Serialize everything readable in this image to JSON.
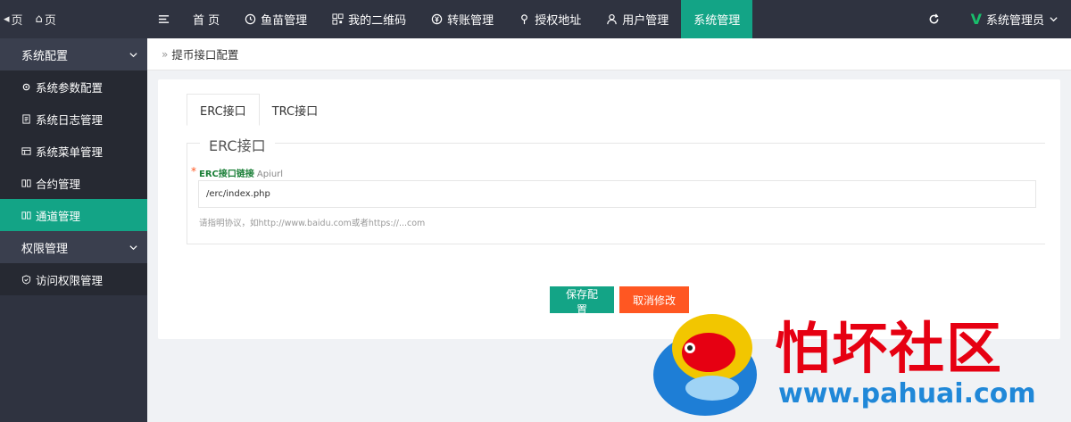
{
  "topbar": {
    "left_links": [
      {
        "icon": "back-icon",
        "label": "页"
      },
      {
        "icon": "home-icon",
        "label": "页"
      }
    ],
    "nav": [
      {
        "name": "nav-menu-toggle",
        "icon": "menu-icon",
        "label": ""
      },
      {
        "name": "nav-home",
        "icon": "",
        "label": "首 页"
      },
      {
        "name": "nav-fish",
        "icon": "fish-icon",
        "label": "鱼苗管理"
      },
      {
        "name": "nav-qrcode",
        "icon": "qrcode-icon",
        "label": "我的二维码"
      },
      {
        "name": "nav-transfer",
        "icon": "yen-icon",
        "label": "转账管理"
      },
      {
        "name": "nav-auth-address",
        "icon": "location-icon",
        "label": "授权地址"
      },
      {
        "name": "nav-users",
        "icon": "user-icon",
        "label": "用户管理"
      },
      {
        "name": "nav-system",
        "icon": "",
        "label": "系统管理",
        "active": true
      }
    ],
    "refresh_icon": "refresh-icon",
    "admin_label": "系统管理员",
    "admin_logo": "V"
  },
  "sidebar": {
    "groups": [
      {
        "label": "系统配置",
        "items": [
          {
            "icon": "gear-icon",
            "label": "系统参数配置"
          },
          {
            "icon": "document-icon",
            "label": "系统日志管理"
          },
          {
            "icon": "menu-table-icon",
            "label": "系统菜单管理"
          },
          {
            "icon": "contract-icon",
            "label": "合约管理"
          },
          {
            "icon": "channel-icon",
            "label": "通道管理",
            "active": true
          }
        ]
      },
      {
        "label": "权限管理",
        "items": [
          {
            "icon": "shield-icon",
            "label": "访问权限管理"
          }
        ]
      }
    ]
  },
  "breadcrumb": {
    "sep": "»",
    "label": "提币接口配置"
  },
  "tabs": [
    {
      "label": "ERC接口",
      "active": true
    },
    {
      "label": "TRC接口",
      "active": false
    }
  ],
  "form": {
    "legend": "ERC接口",
    "required_mark": "*",
    "field_label": "ERC接口链接",
    "field_sublabel": "Apiurl",
    "field_value": "/erc/index.php",
    "field_hint": "请指明协议，如http://www.baidu.com或者https://...com"
  },
  "buttons": {
    "save": "保存配置",
    "cancel": "取消修改"
  },
  "watermark": {
    "text": "怕坏社区",
    "url": "www.pahuai.com"
  },
  "colors": {
    "accent": "#13a486",
    "danger": "#ff5722",
    "dark": "#2f3340"
  }
}
